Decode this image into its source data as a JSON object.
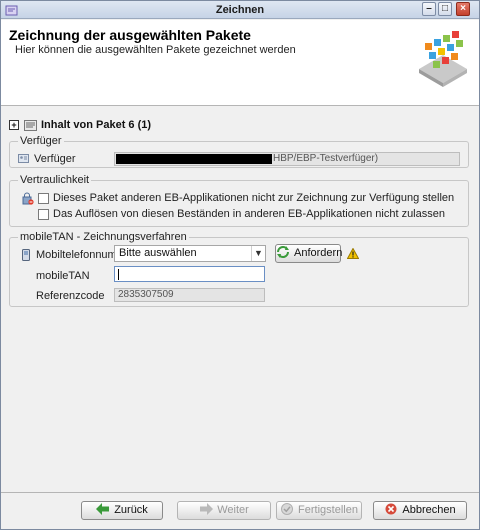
{
  "window": {
    "title": "Zeichnen"
  },
  "header": {
    "title": "Zeichnung der ausgewählten Pakete",
    "subtitle": "Hier können die ausgewählten Pakete gezeichnet werden"
  },
  "package": {
    "label": "Inhalt von Paket 6 (1)",
    "expander": "+"
  },
  "verfueger": {
    "legend": "Verfüger",
    "label": "Verfüger",
    "value_visible": "HBP/EBP-Testverfüger)"
  },
  "vertraulichkeit": {
    "legend": "Vertraulichkeit",
    "option1": "Dieses Paket anderen EB-Applikationen nicht zur Zeichnung zur Verfügung stellen",
    "option2": "Das Auflösen von diesen Beständen in anderen EB-Applikationen nicht zulassen"
  },
  "mobiletan": {
    "legend": "mobileTAN - Zeichnungsverfahren",
    "phone_label": "Mobiltelefonnumı",
    "phone_select_value": "Bitte auswählen",
    "request_button": "Anfordern",
    "tan_label": "mobileTAN",
    "tan_value": "",
    "reference_label": "Referenzcode",
    "reference_value": "2835307509"
  },
  "footer": {
    "back": "Zurück",
    "next": "Weiter",
    "finish": "Fertigstellen",
    "cancel": "Abbrechen"
  },
  "colors": {
    "accent": "#6a8fc4",
    "warning": "#f2c200",
    "cancel_icon": "#d64a3a",
    "ok_icon": "#3a9a3a"
  }
}
